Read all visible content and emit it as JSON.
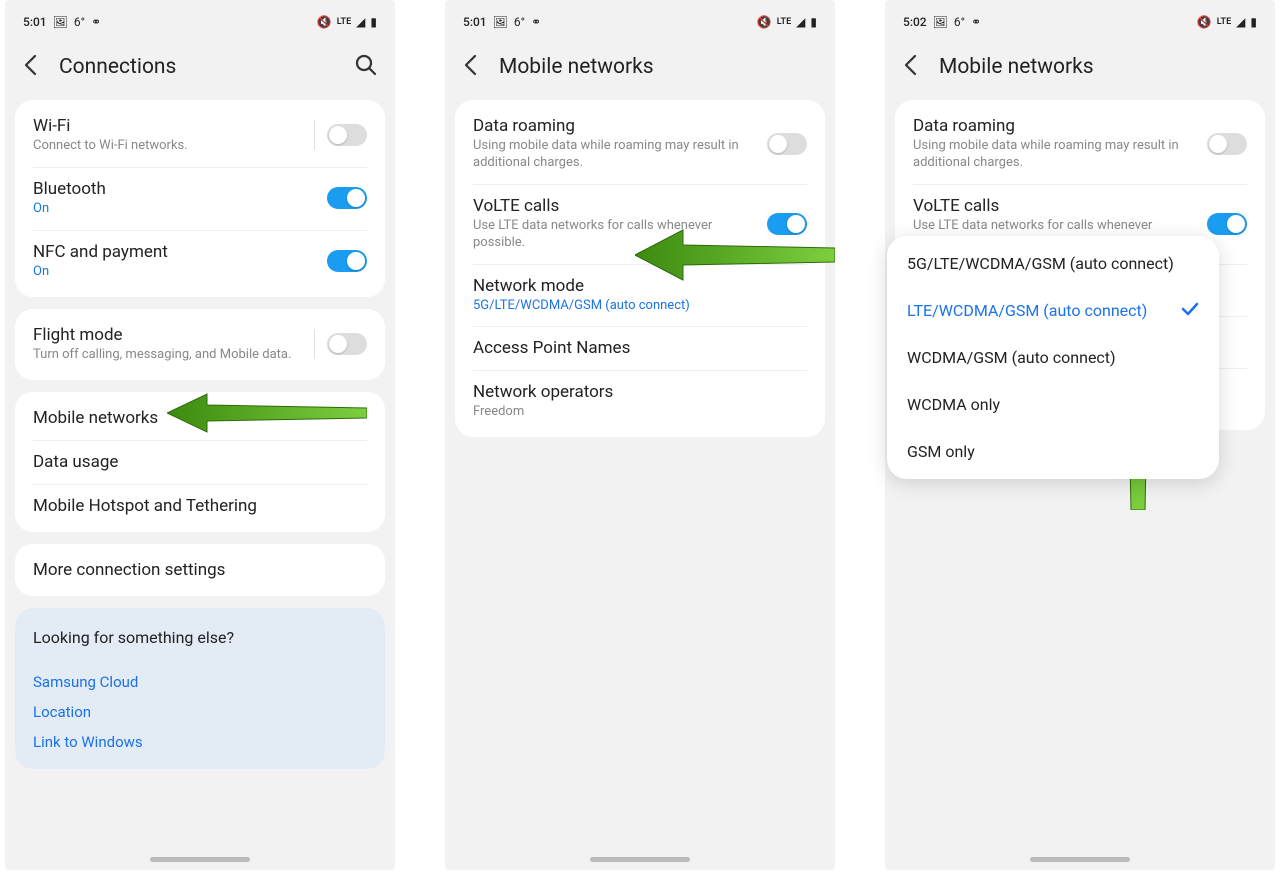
{
  "status": {
    "time1": "5:01",
    "time2": "5:01",
    "time3": "5:02",
    "temp": "6°",
    "lte": "LTE",
    "icons_left": [
      "image-icon",
      "weather-icon",
      "voicemail-icon"
    ],
    "icons_right": [
      "mute-icon",
      "lte-icon",
      "signal-icon",
      "battery-icon"
    ]
  },
  "screen1": {
    "title": "Connections",
    "wifi": {
      "title": "Wi-Fi",
      "sub": "Connect to Wi-Fi networks."
    },
    "bluetooth": {
      "title": "Bluetooth",
      "sub": "On"
    },
    "nfc": {
      "title": "NFC and payment",
      "sub": "On"
    },
    "flight": {
      "title": "Flight mode",
      "sub": "Turn off calling, messaging, and Mobile data."
    },
    "mobile": {
      "title": "Mobile networks"
    },
    "data": {
      "title": "Data usage"
    },
    "hotspot": {
      "title": "Mobile Hotspot and Tethering"
    },
    "more": {
      "title": "More connection settings"
    },
    "tip": {
      "title": "Looking for something else?",
      "links": [
        "Samsung Cloud",
        "Location",
        "Link to Windows"
      ]
    }
  },
  "screen2": {
    "title": "Mobile networks",
    "roaming": {
      "title": "Data roaming",
      "sub": "Using mobile data while roaming may result in additional charges."
    },
    "volte": {
      "title": "VoLTE calls",
      "sub": "Use LTE data networks for calls whenever possible."
    },
    "mode": {
      "title": "Network mode",
      "sub": "5G/LTE/WCDMA/GSM (auto connect)"
    },
    "apn": {
      "title": "Access Point Names"
    },
    "operators": {
      "title": "Network operators",
      "sub": "Freedom"
    }
  },
  "screen3": {
    "title": "Mobile networks",
    "roaming": {
      "title": "Data roaming",
      "sub": "Using mobile data while roaming may result in additional charges."
    },
    "volte": {
      "title": "VoLTE calls",
      "sub": "Use LTE data networks for calls whenever possible."
    },
    "popup": [
      "5G/LTE/WCDMA/GSM (auto connect)",
      "LTE/WCDMA/GSM (auto connect)",
      "WCDMA/GSM (auto connect)",
      "WCDMA only",
      "GSM only"
    ],
    "selected_index": 1
  },
  "arrow_color": "#4da219"
}
